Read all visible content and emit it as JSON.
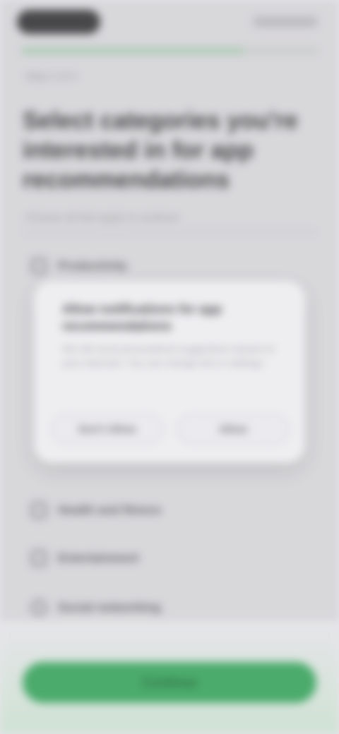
{
  "header": {
    "step_label": "Step 2 of 4",
    "progress_fraction": 0.75
  },
  "main": {
    "title": "Select categories you're interested in for app recommendations",
    "subtitle": "Choose all that apply to continue",
    "options": [
      {
        "label": "Productivity",
        "icon": "checkbox-icon"
      },
      {
        "label": "Health and fitness",
        "icon": "checkbox-icon"
      },
      {
        "label": "Entertainment",
        "icon": "checkbox-icon"
      },
      {
        "label": "Social networking",
        "icon": "radio-circle-icon"
      }
    ]
  },
  "dialog": {
    "title": "Allow notifications for app recommendations",
    "body": "We will send personalized suggestions based on your interests. You can change this in settings.",
    "left_button": "Don't Allow",
    "right_button": "Allow"
  },
  "footer": {
    "cta_label": "Continue"
  },
  "colors": {
    "accent": "#4bab6c",
    "background": "#e6e5e9",
    "dialog": "#eeeef1"
  }
}
